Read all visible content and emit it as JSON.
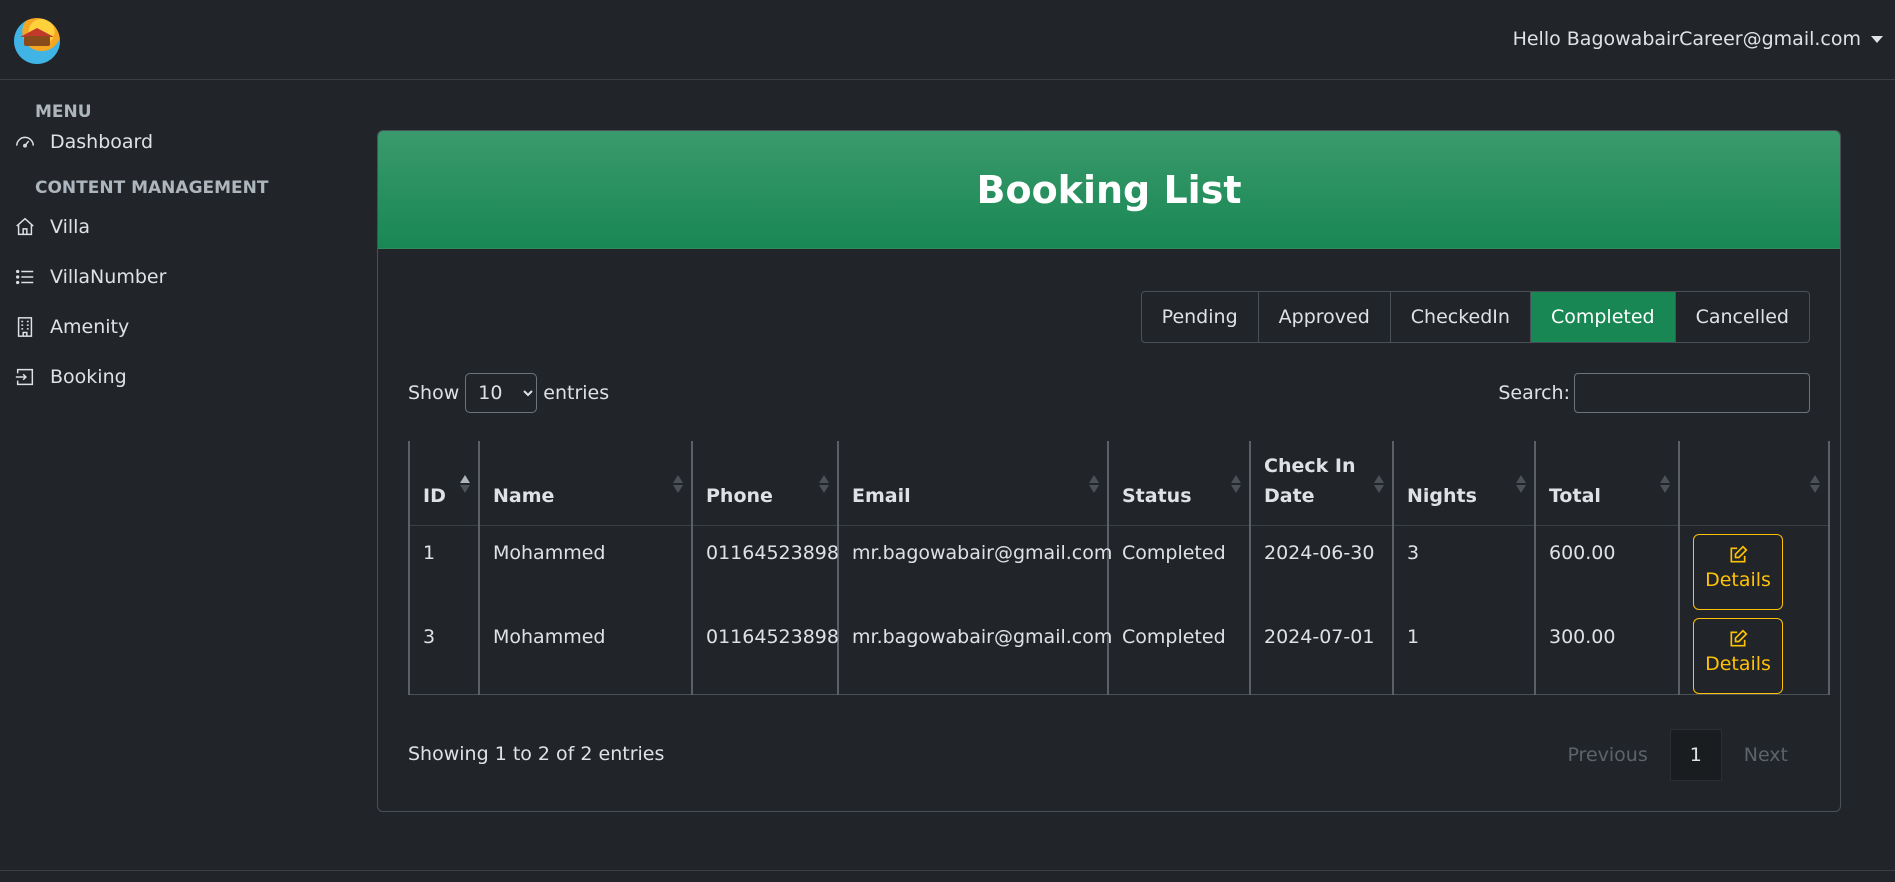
{
  "header": {
    "user_greeting": "Hello BagowabairCareer@gmail.com"
  },
  "sidebar": {
    "menu_title": "MENU",
    "dashboard": "Dashboard",
    "content_title": "CONTENT MANAGEMENT",
    "items": [
      {
        "label": "Villa",
        "icon": "house-icon"
      },
      {
        "label": "VillaNumber",
        "icon": "list-icon"
      },
      {
        "label": "Amenity",
        "icon": "building-icon"
      },
      {
        "label": "Booking",
        "icon": "box-arrow-in-icon"
      }
    ]
  },
  "card": {
    "title": "Booking List"
  },
  "status_filters": [
    "Pending",
    "Approved",
    "CheckedIn",
    "Completed",
    "Cancelled"
  ],
  "active_filter": "Completed",
  "length": {
    "show": "Show",
    "value": "10",
    "entries": "entries"
  },
  "search": {
    "label": "Search:"
  },
  "table": {
    "headers": [
      "ID",
      "Name",
      "Phone",
      "Email",
      "Status",
      "Check In Date",
      "Nights",
      "Total",
      ""
    ],
    "rows": [
      {
        "id": "1",
        "name": "Mohammed",
        "phone": "01164523898",
        "email": "mr.bagowabair@gmail.com",
        "status": "Completed",
        "check_in": "2024-06-30",
        "nights": "3",
        "total": "600.00",
        "action": "Details"
      },
      {
        "id": "3",
        "name": "Mohammed",
        "phone": "01164523898",
        "email": "mr.bagowabair@gmail.com",
        "status": "Completed",
        "check_in": "2024-07-01",
        "nights": "1",
        "total": "300.00",
        "action": "Details"
      }
    ]
  },
  "info": "Showing 1 to 2 of 2 entries",
  "pager": {
    "previous": "Previous",
    "current": "1",
    "next": "Next"
  },
  "colors": {
    "accent": "#198754",
    "warning": "#ffc107",
    "background": "#212529"
  }
}
